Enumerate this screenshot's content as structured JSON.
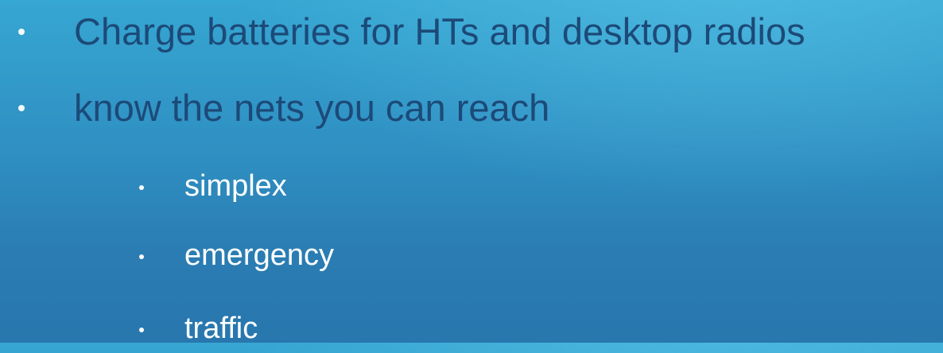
{
  "slide": {
    "bullets": [
      {
        "level": 1,
        "text": "Charge batteries for HTs and desktop radios"
      },
      {
        "level": 1,
        "text": "know the nets you can reach"
      },
      {
        "level": 2,
        "text": "simplex"
      },
      {
        "level": 2,
        "text": "emergency"
      },
      {
        "level": 2,
        "text": "traffic"
      }
    ]
  },
  "colors": {
    "background_top": "#36a6d2",
    "background_bottom": "#2877ae",
    "level1_text": "#1c4a78",
    "level2_text": "#ffffff",
    "bullet_dot": "#ffffff"
  }
}
